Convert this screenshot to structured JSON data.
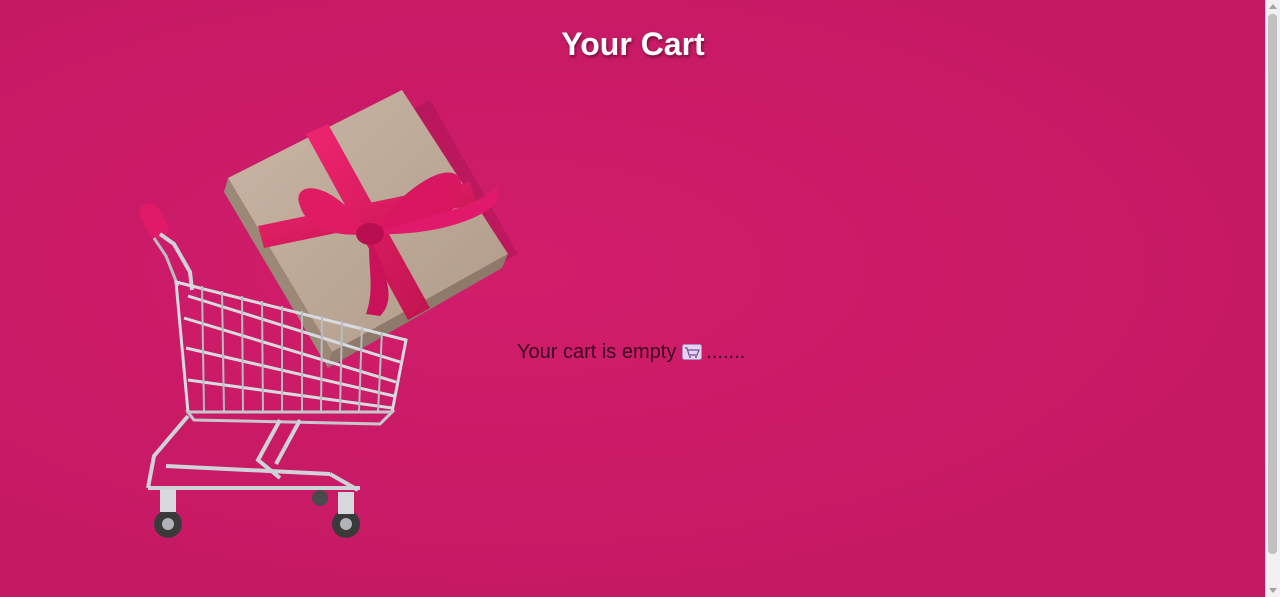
{
  "page": {
    "title": "Your Cart",
    "background_color": "#c91a66"
  },
  "empty_state": {
    "message": "Your cart is empty",
    "trailing": ".......",
    "icon": "shopping-cart-emoji"
  },
  "hero_image": {
    "subject": "shopping-cart-with-gift-box"
  }
}
